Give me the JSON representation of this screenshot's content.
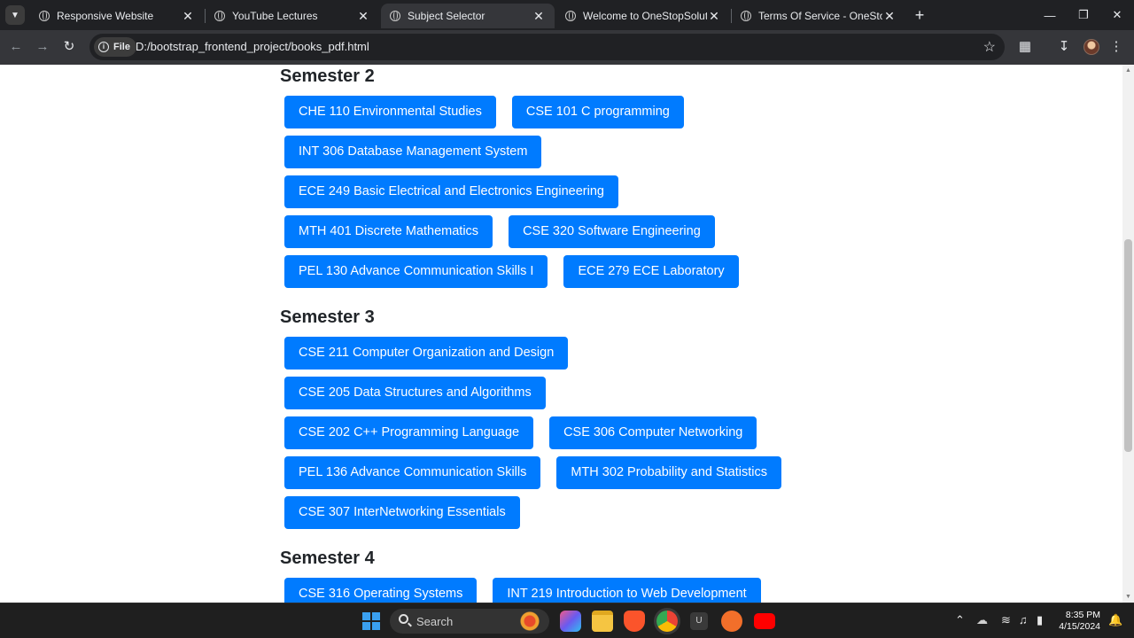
{
  "browser": {
    "tabs": [
      {
        "title": "Responsive Website",
        "active": false
      },
      {
        "title": "YouTube Lectures",
        "active": false
      },
      {
        "title": "Subject Selector",
        "active": true
      },
      {
        "title": "Welcome to OneStopSolutions",
        "active": false
      },
      {
        "title": "Terms Of Service - OneStopSolu",
        "active": false
      }
    ],
    "new_tab_label": "+",
    "file_chip_label": "File",
    "url": "D:/bootstrap_frontend_project/books_pdf.html"
  },
  "semesters": [
    {
      "title": "Semester 2",
      "subjects": [
        "CHE 110 Environmental Studies",
        "CSE 101 C programming",
        "INT 306 Database Management System",
        "ECE 249 Basic Electrical and Electronics Engineering",
        "MTH 401 Discrete Mathematics",
        "CSE 320 Software Engineering",
        "PEL 130 Advance Communication Skills I",
        "ECE 279 ECE Laboratory"
      ]
    },
    {
      "title": "Semester 3",
      "subjects": [
        "CSE 211 Computer Organization and Design",
        "CSE 205 Data Structures and Algorithms",
        "CSE 202 C++ Programming Language",
        "CSE 306 Computer Networking",
        "PEL 136 Advance Communication Skills",
        "MTH 302 Probability and Statistics",
        "CSE 307 InterNetworking Essentials"
      ]
    },
    {
      "title": "Semester 4",
      "subjects": [
        "CSE 316 Operating Systems",
        "INT 219 Introduction to Web Development"
      ]
    }
  ],
  "taskbar": {
    "search_label": "Search",
    "time": "8:35 PM",
    "date": "4/15/2024"
  },
  "colors": {
    "button": "#007bff",
    "button_text": "#ffffff",
    "heading": "#212529",
    "chrome_dark": "#202124",
    "chrome_toolbar": "#35363a"
  }
}
